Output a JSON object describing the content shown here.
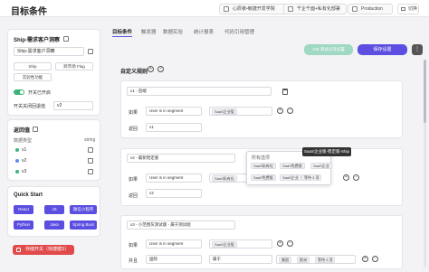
{
  "app": {
    "title": "目标条件"
  },
  "topbar": {
    "chip1": "心辰孝•敏捷开发学院",
    "chip2": "千企千面+私有化部署",
    "chip3": "Production",
    "logout": "切换"
  },
  "left": {
    "ship_title": "Ship-需求客户洞察",
    "ship_field": "Ship-需求客户洞察",
    "tags": [
      "Ship",
      "跨市场 Flag",
      "实验性功能"
    ],
    "toggle_label": "开关已开启",
    "switch_label": "开关关闭回退值",
    "switch_value": "v2",
    "return_title": "返回值",
    "return_col1": "数据类型",
    "return_col2": "string",
    "return_items": [
      "v1",
      "v2",
      "v3"
    ],
    "return_colors": [
      "#3bb47c",
      "#5b8def",
      "#3bb47c"
    ],
    "qs_title": "Quick Start",
    "qs_buttons": [
      "React",
      "JS",
      "微信小程序",
      "Python",
      "Java",
      "Spring Boot"
    ],
    "save_label": "存储开关（快捷键S）"
  },
  "tabs": [
    "目标条件",
    "触发器",
    "数据实验",
    "统计报表",
    "代码引用管理"
  ],
  "toolbar": {
    "green_btn": "A/B 测试分流设置",
    "purple_btn": "保存设置",
    "more": "⋮"
  },
  "section": {
    "title": "自定义规则"
  },
  "rules": [
    {
      "name": "v1 - 后端",
      "if_label": "如果",
      "attr": "User is in segment",
      "op": "",
      "value_pill": "SaaS企业版",
      "return_label": "返回",
      "return_value": "v1"
    },
    {
      "name": "v2 - 最新稳定版",
      "if_label": "如果",
      "attr": "User is in segment",
      "value_pills": [
        "SaaS私有化",
        "SaaS免费版"
      ],
      "extra_dd": "等待 3 项",
      "return_label": "返回",
      "return_value": "v2"
    },
    {
      "name": "v3 - 小范围灰测试版 - 属于测试组",
      "if_label": "如果",
      "attr": "User is in segment",
      "value_pill": "SaaS企业版",
      "and_label": "并且",
      "attr2": "国际",
      "op2": "属于",
      "pills2": [
        "美国",
        "欧洲"
      ],
      "extra_dd2": "等待 3 项"
    }
  ],
  "popup": {
    "title": "所有选项",
    "pills": [
      "SaaS私有化",
      "SaaS免费版",
      "SaaS企业"
    ],
    "pills_row2": [
      "SaaS免费版",
      "SaaS企业"
    ],
    "row2_dd": "等待 3 项"
  },
  "tooltip": "SaaS企业版-稳定版-Ship"
}
